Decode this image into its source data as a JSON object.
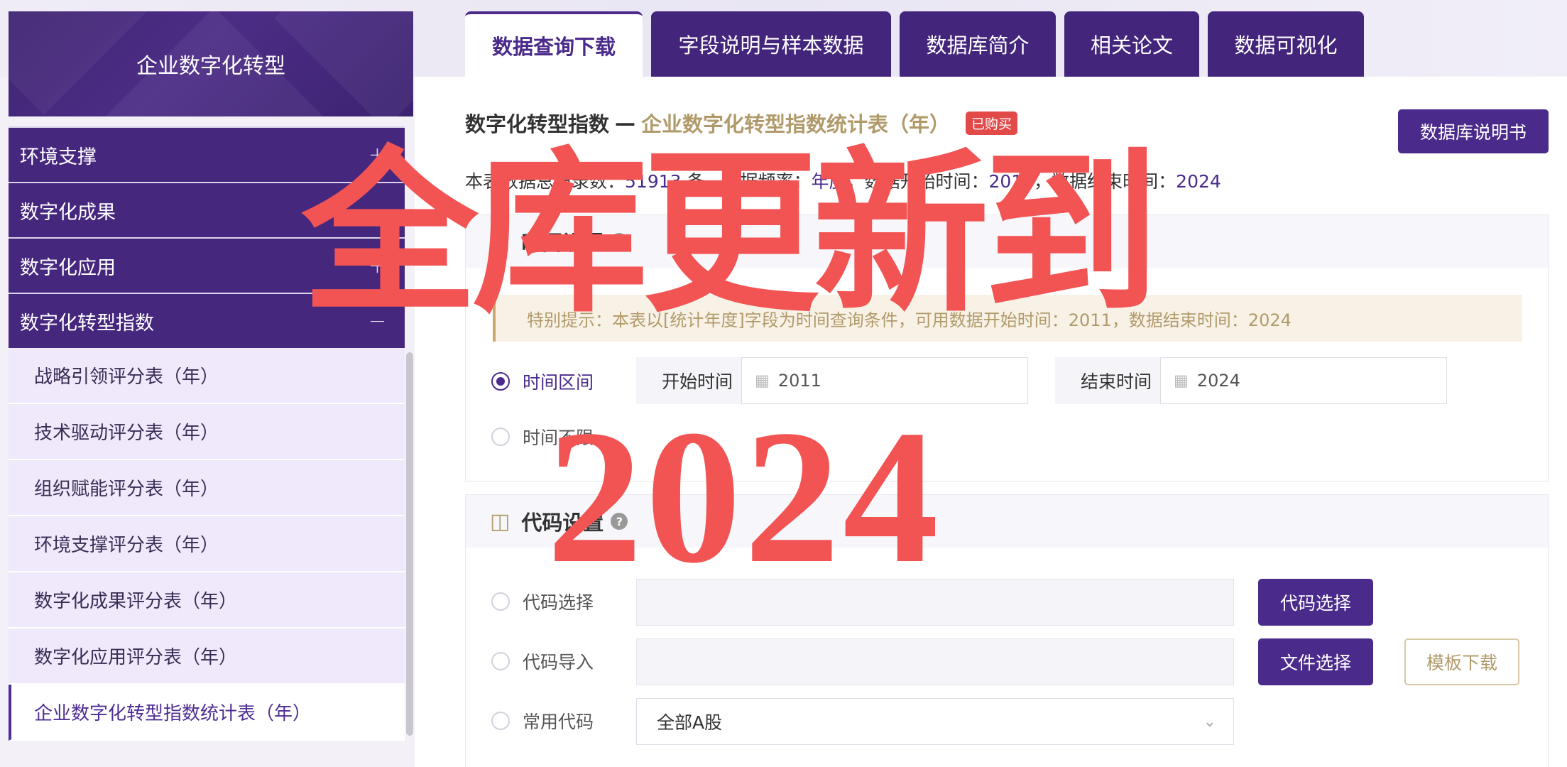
{
  "sidebar": {
    "header": "企业数字化转型",
    "groups": [
      {
        "label": "环境支撑",
        "toggle": "+"
      },
      {
        "label": "数字化成果",
        "toggle": ""
      },
      {
        "label": "数字化应用",
        "toggle": "+"
      },
      {
        "label": "数字化转型指数",
        "toggle": "−"
      }
    ],
    "items": [
      {
        "label": "战略引领评分表（年）"
      },
      {
        "label": "技术驱动评分表（年）"
      },
      {
        "label": "组织赋能评分表（年）"
      },
      {
        "label": "环境支撑评分表（年）"
      },
      {
        "label": "数字化成果评分表（年）"
      },
      {
        "label": "数字化应用评分表（年）"
      },
      {
        "label": "企业数字化转型指数统计表（年）"
      }
    ]
  },
  "tabs": [
    {
      "label": "数据查询下载"
    },
    {
      "label": "字段说明与样本数据"
    },
    {
      "label": "数据库简介"
    },
    {
      "label": "相关论文"
    },
    {
      "label": "数据可视化"
    }
  ],
  "header": {
    "prefix": "数字化转型指数",
    "dash": "—",
    "table_name": "企业数字化转型指数统计表（年）",
    "badge": "已购买",
    "manual_button": "数据库说明书"
  },
  "info": {
    "l1": "本表数据总记录数：",
    "records": "51913",
    "l2": " 条，数据频率：",
    "frequency": "年度",
    "l3": "，数据开始时间：",
    "start": "2011",
    "l4": "，数据结束时间：",
    "end": "2024"
  },
  "time_panel": {
    "title": "时间设置",
    "notice": "特别提示：本表以[统计年度]字段为时间查询条件，可用数据开始时间：2011，数据结束时间：2024",
    "option_range": "时间区间",
    "option_unlimited": "时间不限",
    "start_label": "开始时间",
    "start_value": "2011",
    "end_label": "结束时间",
    "end_value": "2024"
  },
  "code_panel": {
    "title": "代码设置",
    "opt_select": "代码选择",
    "opt_import": "代码导入",
    "opt_common": "常用代码",
    "select_button": "代码选择",
    "file_button": "文件选择",
    "template_button": "模板下载",
    "common_value": "全部A股"
  },
  "overlay": {
    "line1": "全库更新到",
    "line2": "2024"
  },
  "colors": {
    "primary": "#4a2a8a",
    "gold": "#b19a6a",
    "overlay_red": "#f25454",
    "badge_red": "#e24a4a"
  }
}
